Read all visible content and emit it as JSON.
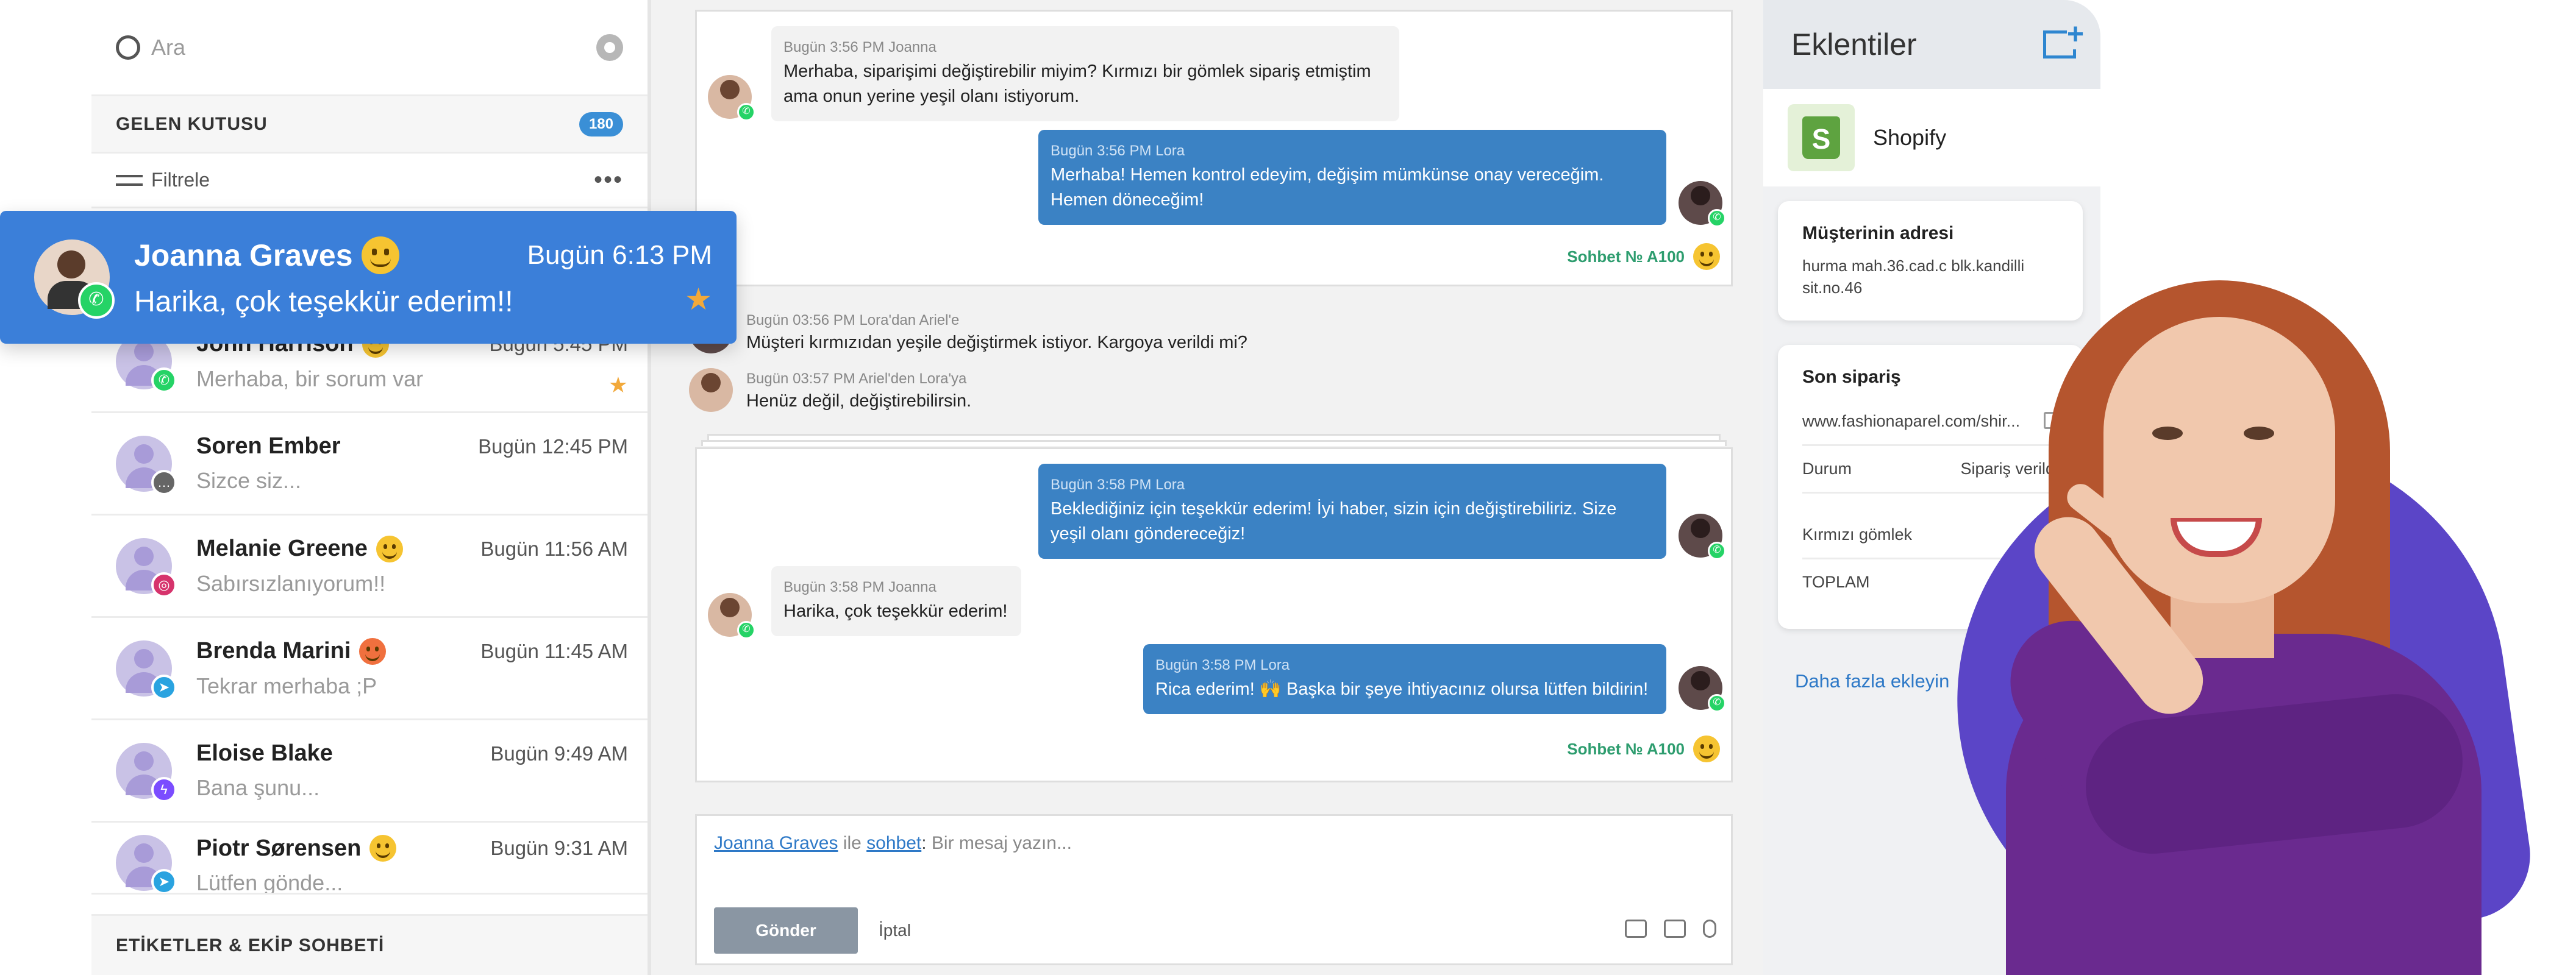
{
  "sidebar": {
    "search_placeholder": "Ara",
    "inbox_title": "GELEN KUTUSU",
    "inbox_count": "180",
    "filter_label": "Filtrele",
    "more_dots": "•••",
    "footer_title": "ETİKETLER & EKİP SOHBETİ",
    "highlight": {
      "name": "Joanna Graves",
      "time": "Bugün 6:13 PM",
      "message": "Harika, çok teşekkür ederim!!",
      "channel": "whatsapp"
    },
    "conversations": [
      {
        "name": "John Harrison",
        "time": "Bugün 5:45 PM",
        "message": "Merhaba, bir sorum var",
        "channel": "whatsapp",
        "emoji": "smile",
        "starred": true
      },
      {
        "name": "Soren Ember",
        "time": "Bugün 12:45 PM",
        "message": "Sizce siz...",
        "channel": "chat",
        "emoji": "",
        "starred": false
      },
      {
        "name": "Melanie Greene",
        "time": "Bugün 11:56 AM",
        "message": "Sabırsızlanıyorum!!",
        "channel": "instagram",
        "emoji": "smile",
        "starred": false
      },
      {
        "name": "Brenda Marini",
        "time": "Bugün 11:45 AM",
        "message": "Tekrar merhaba ;P",
        "channel": "telegram",
        "emoji": "angry",
        "starred": false
      },
      {
        "name": "Eloise Blake",
        "time": "Bugün 9:49 AM",
        "message": "Bana şunu...",
        "channel": "messenger",
        "emoji": "",
        "starred": false
      },
      {
        "name": "Piotr Sørensen",
        "time": "Bugün 9:31 AM",
        "message": "Lütfen gönde...",
        "channel": "telegram",
        "emoji": "smile",
        "starred": false
      }
    ]
  },
  "chat": {
    "m1_meta": "Bugün 3:56 PM Joanna",
    "m1_text": "Merhaba, siparişimi değiştirebilir miyim? Kırmızı bir gömlek sipariş etmiştim ama onun yerine yeşil olanı istiyorum.",
    "m2_meta": "Bugün 3:56 PM Lora",
    "m2_text": "Merhaba! Hemen kontrol edeyim, değişim mümkünse onay vereceğim. Hemen döneceğim!",
    "session1": "Sohbet № A100",
    "n1_meta": "Bugün 03:56 PM Lora'dan Ariel'e",
    "n1_text": "Müşteri kırmızıdan yeşile değiştirmek istiyor. Kargoya verildi mi?",
    "n2_meta": "Bugün 03:57 PM Ariel'den Lora'ya",
    "n2_text": "Henüz değil, değiştirebilirsin.",
    "m3_meta": "Bugün 3:58 PM Lora",
    "m3_text": "Beklediğiniz için teşekkür ederim! İyi haber, sizin için değiştirebiliriz. Size yeşil olanı göndereceğiz!",
    "m4_meta": "Bugün 3:58 PM Joanna",
    "m4_text": "Harika, çok teşekkür ederim!",
    "m5_meta": "Bugün 3:58 PM Lora",
    "m5_text": "Rica ederim! 🙌 Başka bir şeye ihtiyacınız olursa lütfen bildirin!",
    "session2": "Sohbet № A100"
  },
  "composer": {
    "contact": "Joanna Graves",
    "with": " ile ",
    "chat_link": "sohbet",
    "colon": ":",
    "placeholder": " Bir mesaj yazın...",
    "send": "Gönder",
    "cancel": "İptal"
  },
  "plugins": {
    "title": "Eklentiler",
    "shopify": "Shopify",
    "shopify_letter": "S",
    "address_title": "Müşterinin adresi",
    "address_value": "hurma mah.36.cad.c blk.kandilli sit.no.46",
    "order_title": "Son sipariş",
    "order_url": "www.fashionaparel.com/shir...",
    "status_label": "Durum",
    "status_value": "Sipariş verildi",
    "item": "Kırmızı gömlek",
    "total": "TOPLAM",
    "more": "Daha fazla ekleyin"
  },
  "colors": {
    "accent": "#3b7fd9",
    "outgoing": "#3b82c4",
    "session": "#2e9d6f",
    "purple": "#5b45c7"
  }
}
